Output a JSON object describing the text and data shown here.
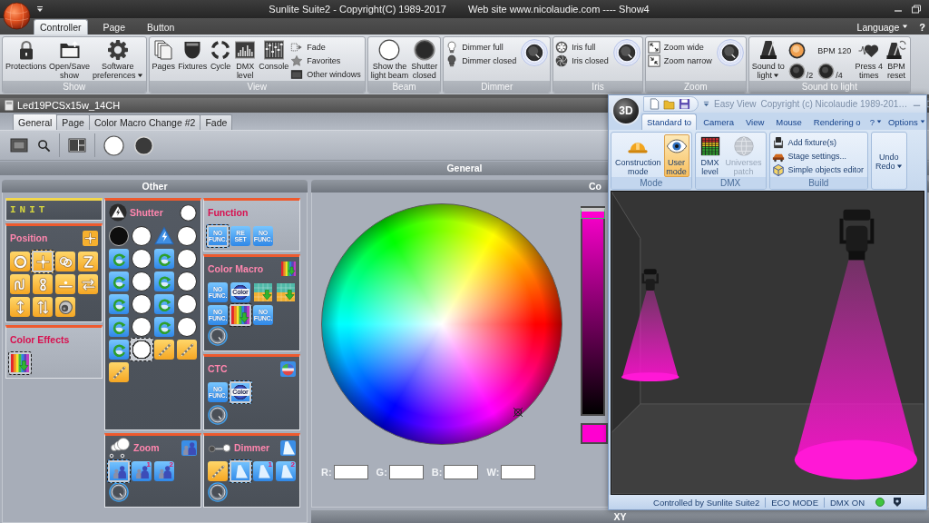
{
  "window": {
    "title": "Sunlite Suite2 - Copyright(C) 1989-2017",
    "website": "Web site www.nicolaudie.com ---- Show4"
  },
  "tabs": [
    {
      "label": "Controller",
      "selected": true
    },
    {
      "label": "Page",
      "selected": false
    },
    {
      "label": "Button",
      "selected": false
    }
  ],
  "language": {
    "label": "Language",
    "dropdown": true
  },
  "help": "?",
  "ribbon": [
    {
      "label": "Show",
      "knob": false,
      "buttons": [
        {
          "label": "Protections",
          "kind": "lock",
          "dropdown": false
        },
        {
          "label": "Open/Save show",
          "kind": "folder",
          "dropdown": false
        },
        {
          "label": "Software preferences",
          "kind": "gear",
          "dropdown": true
        }
      ]
    },
    {
      "label": "View",
      "knob": false,
      "buttons": [
        {
          "label": "Pages",
          "kind": "pages"
        },
        {
          "label": "Fixtures",
          "kind": "fixture"
        },
        {
          "label": "Cycle",
          "kind": "cycle"
        },
        {
          "label": "DMX level",
          "kind": "dmx"
        },
        {
          "label": "Console",
          "kind": "console"
        }
      ],
      "small": [
        {
          "label": "Fade",
          "kind": "fade"
        },
        {
          "label": "Favorites",
          "kind": "favorites"
        },
        {
          "label": "Other windows",
          "kind": "windows"
        }
      ]
    },
    {
      "label": "Beam",
      "knob": false,
      "buttons": [
        {
          "label": "Show the light beam",
          "kind": "open"
        },
        {
          "label": "Shutter closed",
          "kind": "closed"
        }
      ]
    },
    {
      "label": "Dimmer",
      "knob": true,
      "small": [
        {
          "label": "Dimmer full",
          "kind": "bulb-on"
        },
        {
          "label": "Dimmer closed",
          "kind": "bulb-off"
        }
      ]
    },
    {
      "label": "Iris",
      "knob": true,
      "small": [
        {
          "label": "Iris full",
          "kind": "iris-open"
        },
        {
          "label": "Iris closed",
          "kind": "iris-closed"
        }
      ]
    },
    {
      "label": "Zoom",
      "knob": true,
      "small": [
        {
          "label": "Zoom wide",
          "kind": "zoom-wide"
        },
        {
          "label": "Zoom narrow",
          "kind": "zoom-narrow"
        }
      ]
    },
    {
      "label": "Sound to light",
      "knob": false,
      "buttons": [
        {
          "label": "Sound to light",
          "kind": "metronome",
          "dropdown": true
        },
        {
          "kind": "tempo",
          "beat_on": true,
          "bpm": "BPM 120",
          "dividers": [
            "/2",
            "/4"
          ]
        },
        {
          "label": "Press 4 times",
          "kind": "heart",
          "dropdown": false
        },
        {
          "label": "BPM reset",
          "kind": "metronome-reset",
          "dropdown": false
        }
      ]
    }
  ],
  "fixture_window": {
    "title": "Led19PCSx15w_14CH",
    "tabs": [
      {
        "label": "General",
        "selected": true
      },
      {
        "label": "Page",
        "selected": false
      },
      {
        "label": "Color Macro Change #2",
        "selected": false
      },
      {
        "label": "Fade",
        "selected": false
      }
    ],
    "toolbar": [
      {
        "items": [
          {
            "kind": "screen"
          },
          {
            "kind": "search"
          }
        ]
      },
      {
        "items": [
          {
            "kind": "layout"
          }
        ]
      },
      {
        "items": [
          {
            "kind": "open"
          },
          {
            "kind": "closed"
          }
        ]
      }
    ],
    "section": "General",
    "other": {
      "title": "Other",
      "columns": [
        {
          "panels": [
            {
              "title": "INIT",
              "kind": "init",
              "active": true,
              "knob": false
            },
            {
              "title": "Position",
              "kind": "position",
              "active": true,
              "knob": false,
              "buttons": [
                {
                  "kind": "ring",
                  "selected": false
                },
                {
                  "kind": "center",
                  "selected": true
                },
                {
                  "kind": "rings",
                  "selected": false
                },
                {
                  "kind": "zigzag",
                  "selected": false
                },
                {
                  "kind": "squiggle",
                  "selected": false
                },
                {
                  "kind": "eight",
                  "selected": false
                },
                {
                  "kind": "line",
                  "selected": false
                },
                {
                  "kind": "swap",
                  "selected": false
                },
                {
                  "kind": "vertical",
                  "selected": false
                },
                {
                  "kind": "double-vertical",
                  "selected": false
                },
                {
                  "kind": "spot",
                  "selected": false
                }
              ]
            },
            {
              "title": "Color Effects",
              "kind": "effects",
              "active": false,
              "knob": false,
              "buttons": [
                {
                  "kind": "rainbow",
                  "selected": true
                }
              ]
            }
          ]
        },
        {
          "panels": [
            {
              "title": "Shutter",
              "kind": "shutter",
              "active": true,
              "knob": false,
              "buttons": [
                {
                  "kind": "closed",
                  "selected": false
                },
                {
                  "kind": "open",
                  "selected": false
                },
                {
                  "kind": "strobe",
                  "selected": false
                },
                {
                  "kind": "open",
                  "selected": false
                },
                {
                  "kind": "cycle",
                  "selected": false
                },
                {
                  "kind": "open",
                  "selected": false
                },
                {
                  "kind": "cycle",
                  "selected": false
                },
                {
                  "kind": "open",
                  "selected": false
                },
                {
                  "kind": "cycle",
                  "selected": false
                },
                {
                  "kind": "open",
                  "selected": false
                },
                {
                  "kind": "cycle",
                  "selected": false
                },
                {
                  "kind": "open",
                  "selected": false
                },
                {
                  "kind": "cycle",
                  "selected": false
                },
                {
                  "kind": "open",
                  "selected": false
                },
                {
                  "kind": "cycle",
                  "selected": false
                },
                {
                  "kind": "open",
                  "selected": false
                },
                {
                  "kind": "cycle",
                  "selected": false
                },
                {
                  "kind": "open",
                  "selected": false
                },
                {
                  "kind": "cycle",
                  "selected": false
                },
                {
                  "kind": "open",
                  "selected": false
                },
                {
                  "kind": "cycle",
                  "selected": false
                },
                {
                  "kind": "open",
                  "selected": true
                },
                {
                  "kind": "ramp",
                  "selected": false
                },
                {
                  "kind": "ramp",
                  "selected": false
                },
                {
                  "kind": "ramp",
                  "selected": false
                }
              ]
            },
            {
              "title": "Zoom",
              "kind": "zoom",
              "active": true,
              "knob": true,
              "buttons": [
                {
                  "kind": "figures",
                  "selected": true
                },
                {
                  "kind": "figures",
                  "label": "1",
                  "selected": false
                },
                {
                  "kind": "figures",
                  "label": "2",
                  "selected": false
                }
              ]
            }
          ]
        },
        {
          "panels": [
            {
              "title": "Function",
              "kind": "function",
              "active": false,
              "knob": false,
              "buttons": [
                {
                  "kind": "text",
                  "label": "NO FUNC.",
                  "selected": true
                },
                {
                  "kind": "reset",
                  "label": "RE SET",
                  "selected": false
                },
                {
                  "kind": "text",
                  "label": "NO FUNC.",
                  "selected": false
                }
              ]
            },
            {
              "title": "Color Macro",
              "kind": "color-macro",
              "active": true,
              "knob": true,
              "buttons": [
                {
                  "kind": "text",
                  "label": "NO FUNC.",
                  "selected": false
                },
                {
                  "kind": "color-ball",
                  "label": "Color",
                  "selected": false
                },
                {
                  "kind": "gradient",
                  "selected": false
                },
                {
                  "kind": "gradient",
                  "selected": false
                },
                {
                  "kind": "text",
                  "label": "NO FUNC.",
                  "selected": false
                },
                {
                  "kind": "rainbow",
                  "selected": true
                },
                {
                  "kind": "text",
                  "label": "NO FUNC.",
                  "selected": false
                }
              ]
            },
            {
              "title": "CTC",
              "kind": "ctc",
              "active": true,
              "knob": true,
              "buttons": [
                {
                  "kind": "text",
                  "label": "NO FUNC.",
                  "selected": false
                },
                {
                  "kind": "color-ball",
                  "label": "Color",
                  "selected": true
                }
              ]
            },
            {
              "title": "Dimmer",
              "kind": "dimmer",
              "active": true,
              "knob": true,
              "buttons": [
                {
                  "kind": "ramp",
                  "selected": false
                },
                {
                  "kind": "beam",
                  "selected": true
                },
                {
                  "kind": "beam",
                  "label": "1",
                  "selected": false
                },
                {
                  "kind": "beam",
                  "label": "2",
                  "selected": false
                }
              ]
            }
          ]
        }
      ]
    },
    "color_picker": {
      "title": "Co",
      "color": "#ff00d0",
      "brightness": {
        "level": 1
      },
      "fields": [
        {
          "label": "R:"
        },
        {
          "label": "G:"
        },
        {
          "label": "B:"
        },
        {
          "label": "W:"
        }
      ]
    },
    "xy": "XY"
  },
  "easy_view": {
    "logo": "3D",
    "title": "Easy View",
    "copyright": "Copyright (c) Nicolaudie 1989-201…",
    "tabs": [
      {
        "label": "Standard to",
        "selected": true
      },
      {
        "label": "Camera",
        "selected": false
      },
      {
        "label": "View",
        "selected": false
      },
      {
        "label": "Mouse",
        "selected": false
      },
      {
        "label": "Rendering o",
        "selected": false
      }
    ],
    "menus": [
      {
        "label": "?",
        "dropdown": true
      },
      {
        "label": "Options",
        "dropdown": true
      }
    ],
    "ribbon": [
      {
        "label": "Mode",
        "buttons": [
          {
            "label": "Construction mode",
            "kind": "hard-hat",
            "selected": false
          },
          {
            "label": "User mode",
            "kind": "eye",
            "selected": true
          }
        ]
      },
      {
        "label": "DMX",
        "buttons": [
          {
            "label": "DMX level",
            "kind": "meter",
            "disabled": false
          },
          {
            "label": "Universes patch",
            "kind": "globe",
            "disabled": true
          }
        ]
      },
      {
        "label": "Build",
        "small": [
          {
            "label": "Add fixture(s)",
            "kind": "add-fixture"
          },
          {
            "label": "Stage settings...",
            "kind": "stage"
          },
          {
            "label": "Simple objects editor",
            "kind": "cube"
          }
        ]
      },
      {
        "buttons": [
          {
            "label": "Undo Redo",
            "kind": "undo",
            "dropdown": true
          }
        ]
      }
    ],
    "status": [
      "Controlled by Sunlite Suite2",
      "ECO MODE",
      "DMX ON"
    ]
  }
}
